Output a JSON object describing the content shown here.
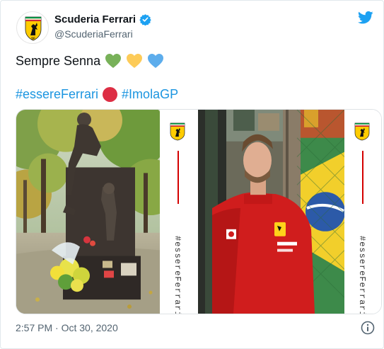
{
  "account": {
    "display_name": "Scuderia Ferrari",
    "handle": "@ScuderiaFerrari",
    "verified": true
  },
  "tweet": {
    "text": "Sempre Senna",
    "emojis": [
      "green-heart-icon",
      "yellow-heart-icon",
      "blue-heart-icon"
    ],
    "hashtag_1": "#essereFerrari",
    "hashtag_2": "#ImolaGP",
    "timestamp": "2:57 PM · Oct 30, 2020"
  },
  "media": {
    "strip_text": "#essereFerrari"
  },
  "colors": {
    "link": "#1b95e0",
    "ferrari_red": "#d40000",
    "twitter_blue": "#1da1f2",
    "text_secondary": "#536471"
  }
}
